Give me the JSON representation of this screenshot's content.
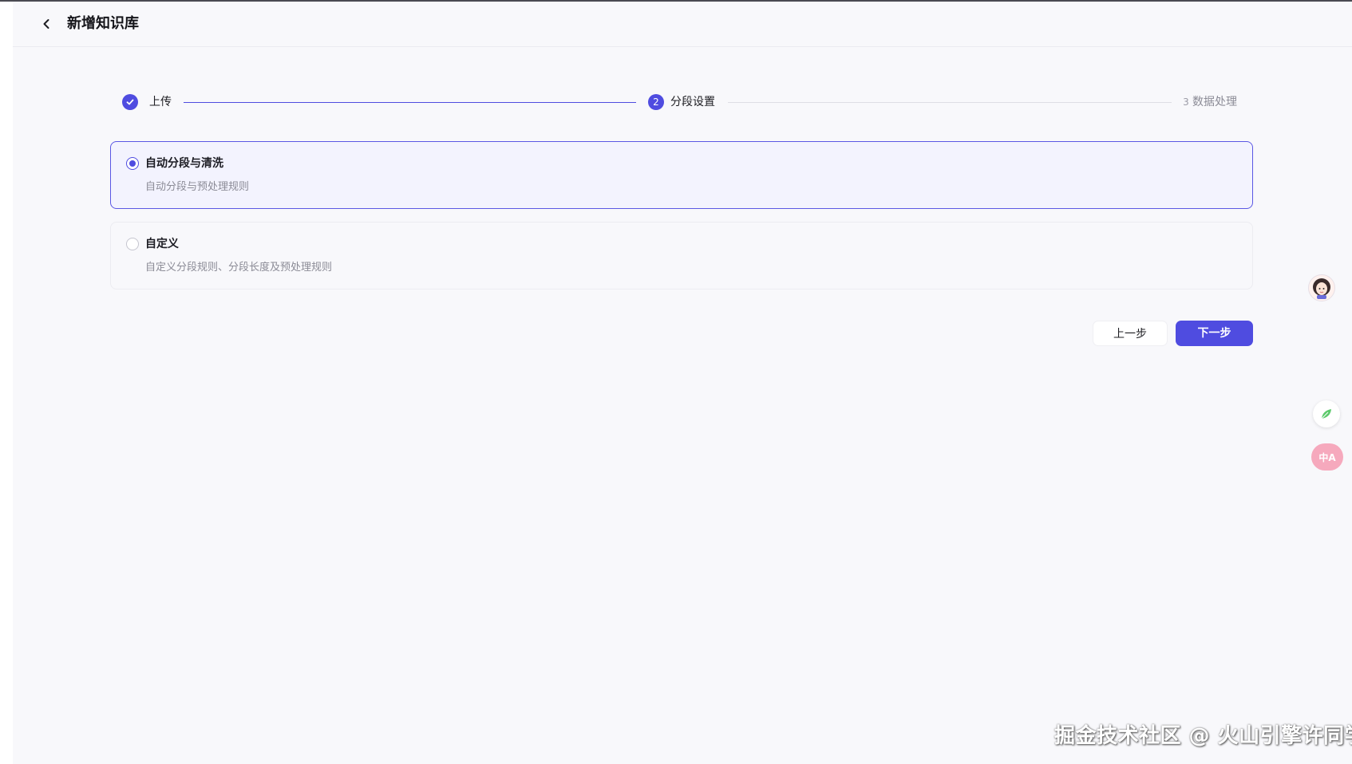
{
  "header": {
    "title": "新增知识库"
  },
  "steps": [
    {
      "label": "上传",
      "state": "done"
    },
    {
      "label": "分段设置",
      "number": "2",
      "state": "active"
    },
    {
      "label": "数据处理",
      "number": "3",
      "state": "pending"
    }
  ],
  "options": [
    {
      "title": "自动分段与清洗",
      "description": "自动分段与预处理规则",
      "selected": true
    },
    {
      "title": "自定义",
      "description": "自定义分段规则、分段长度及预处理规则",
      "selected": false
    }
  ],
  "buttons": {
    "prev": "上一步",
    "next": "下一步"
  },
  "floating": {
    "translate_label": "中A"
  },
  "watermark": "掘金技术社区 @ 火山引擎许同学",
  "colors": {
    "accent": "#4f4ce0",
    "card_selected_bg": "#f3f3fe",
    "page_bg": "#f8f8fb"
  }
}
